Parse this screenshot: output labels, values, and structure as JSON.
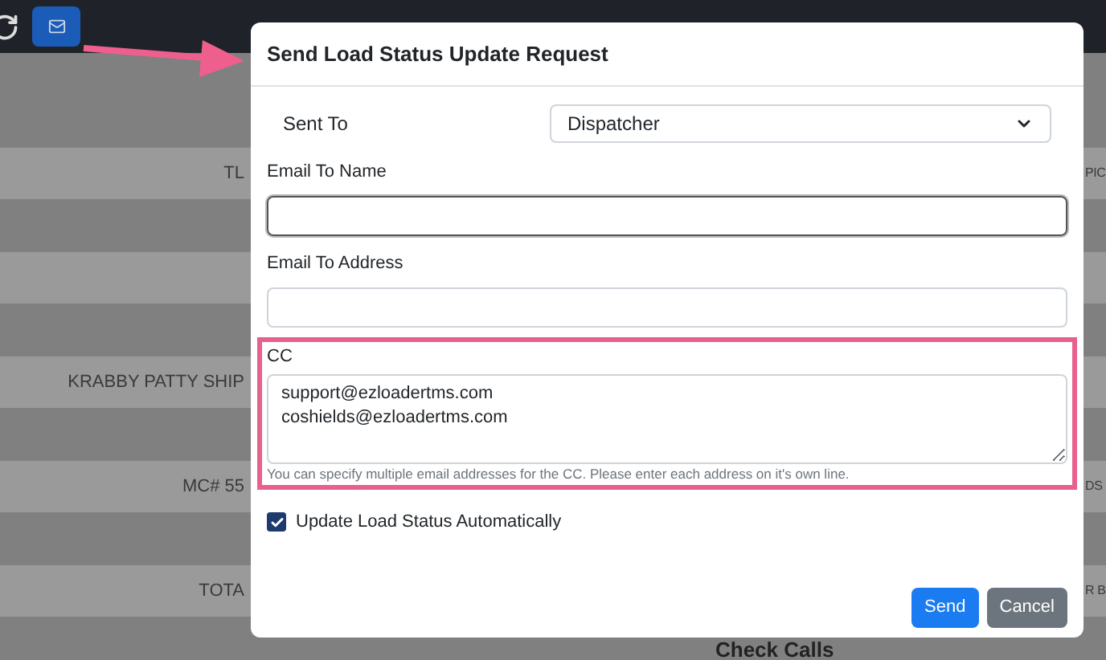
{
  "background": {
    "rows": [
      {
        "left": "TL",
        "right": "PIC"
      },
      {},
      {
        "left": "KRABBY PATTY SHIP"
      },
      {
        "left": "MC# 55",
        "right": "DS"
      },
      {
        "left": "TOTA",
        "right": "R B"
      }
    ],
    "heading": "Check Calls"
  },
  "modal": {
    "title": "Send Load Status Update Request",
    "fields": [
      {
        "kind": "select",
        "label": "Sent To",
        "value": "Dispatcher"
      },
      {
        "kind": "text",
        "label": "Email To Name",
        "focused": true
      },
      {
        "kind": "text",
        "label": "Email To Address",
        "focused": false
      },
      {
        "kind": "textarea",
        "label": "CC",
        "lines": [
          "support@ezloadertms.com",
          "coshields@ezloadertms.com"
        ],
        "help": "You can specify multiple email addresses for the CC. Please enter each address on it's own line.",
        "highlighted": true
      }
    ],
    "checkbox": {
      "label": "Update Load Status Automatically",
      "checked": true
    },
    "buttons": [
      {
        "label": "Send",
        "kind": "primary"
      },
      {
        "label": "Cancel",
        "kind": "secondary"
      }
    ]
  }
}
